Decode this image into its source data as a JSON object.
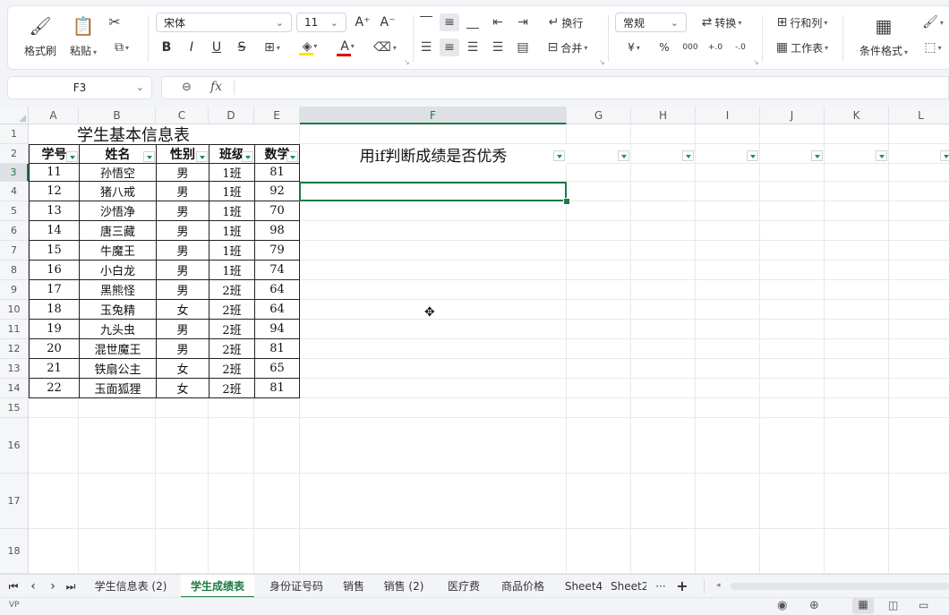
{
  "ribbon": {
    "format_painter": "格式刷",
    "paste": "粘贴",
    "font_name": "宋体",
    "font_size": "11",
    "wrap": "换行",
    "merge": "合并",
    "number_format": "常规",
    "convert": "转换",
    "rows_cols": "行和列",
    "worksheet": "工作表",
    "cond_format": "条件格式",
    "bold": "B",
    "italic": "I",
    "underline": "U",
    "strike": "S",
    "font_color_letter": "A",
    "currency": "¥",
    "percent": "%",
    "thousands": "000",
    "dec_inc": "+.0",
    "dec_dec": "-.0",
    "grow_font": "A⁺",
    "shrink_font": "A⁻",
    "fill_color": "#ffe400",
    "font_color": "#e00000"
  },
  "formula_bar": {
    "name_box": "F3",
    "fx": "fx",
    "value": ""
  },
  "columns": [
    "A",
    "B",
    "C",
    "D",
    "E",
    "F",
    "G",
    "H",
    "I",
    "J",
    "K",
    "L"
  ],
  "rows": [
    "1",
    "2",
    "3",
    "4",
    "5",
    "6",
    "7",
    "8",
    "9",
    "10",
    "11",
    "12",
    "13",
    "14",
    "15",
    "16",
    "17",
    "18"
  ],
  "sheet": {
    "title": "学生基本信息表",
    "f2_text": "用if判断成绩是否优秀",
    "headers": [
      "学号",
      "姓名",
      "性别",
      "班级",
      "数学"
    ],
    "records": [
      [
        "11",
        "孙悟空",
        "男",
        "1班",
        "81"
      ],
      [
        "12",
        "猪八戒",
        "男",
        "1班",
        "92"
      ],
      [
        "13",
        "沙悟净",
        "男",
        "1班",
        "70"
      ],
      [
        "14",
        "唐三藏",
        "男",
        "1班",
        "98"
      ],
      [
        "15",
        "牛魔王",
        "男",
        "1班",
        "79"
      ],
      [
        "16",
        "小白龙",
        "男",
        "1班",
        "74"
      ],
      [
        "17",
        "黑熊怪",
        "男",
        "2班",
        "64"
      ],
      [
        "18",
        "玉兔精",
        "女",
        "2班",
        "64"
      ],
      [
        "19",
        "九头虫",
        "男",
        "2班",
        "94"
      ],
      [
        "20",
        "混世魔王",
        "男",
        "2班",
        "81"
      ],
      [
        "21",
        "铁扇公主",
        "女",
        "2班",
        "65"
      ],
      [
        "22",
        "玉面狐狸",
        "女",
        "2班",
        "81"
      ]
    ],
    "selected_cell": "F3",
    "accent": "#1e7a45"
  },
  "tabs": [
    "学生信息表 (2)",
    "学生成绩表",
    "身份证号码",
    "销售",
    "销售 (2)",
    "医疗费",
    "商品价格",
    "Sheet4",
    "Sheet2"
  ],
  "active_tab": "学生成绩表",
  "tab_more": "···",
  "tab_add": "+",
  "status": {
    "left_text": "VP"
  }
}
